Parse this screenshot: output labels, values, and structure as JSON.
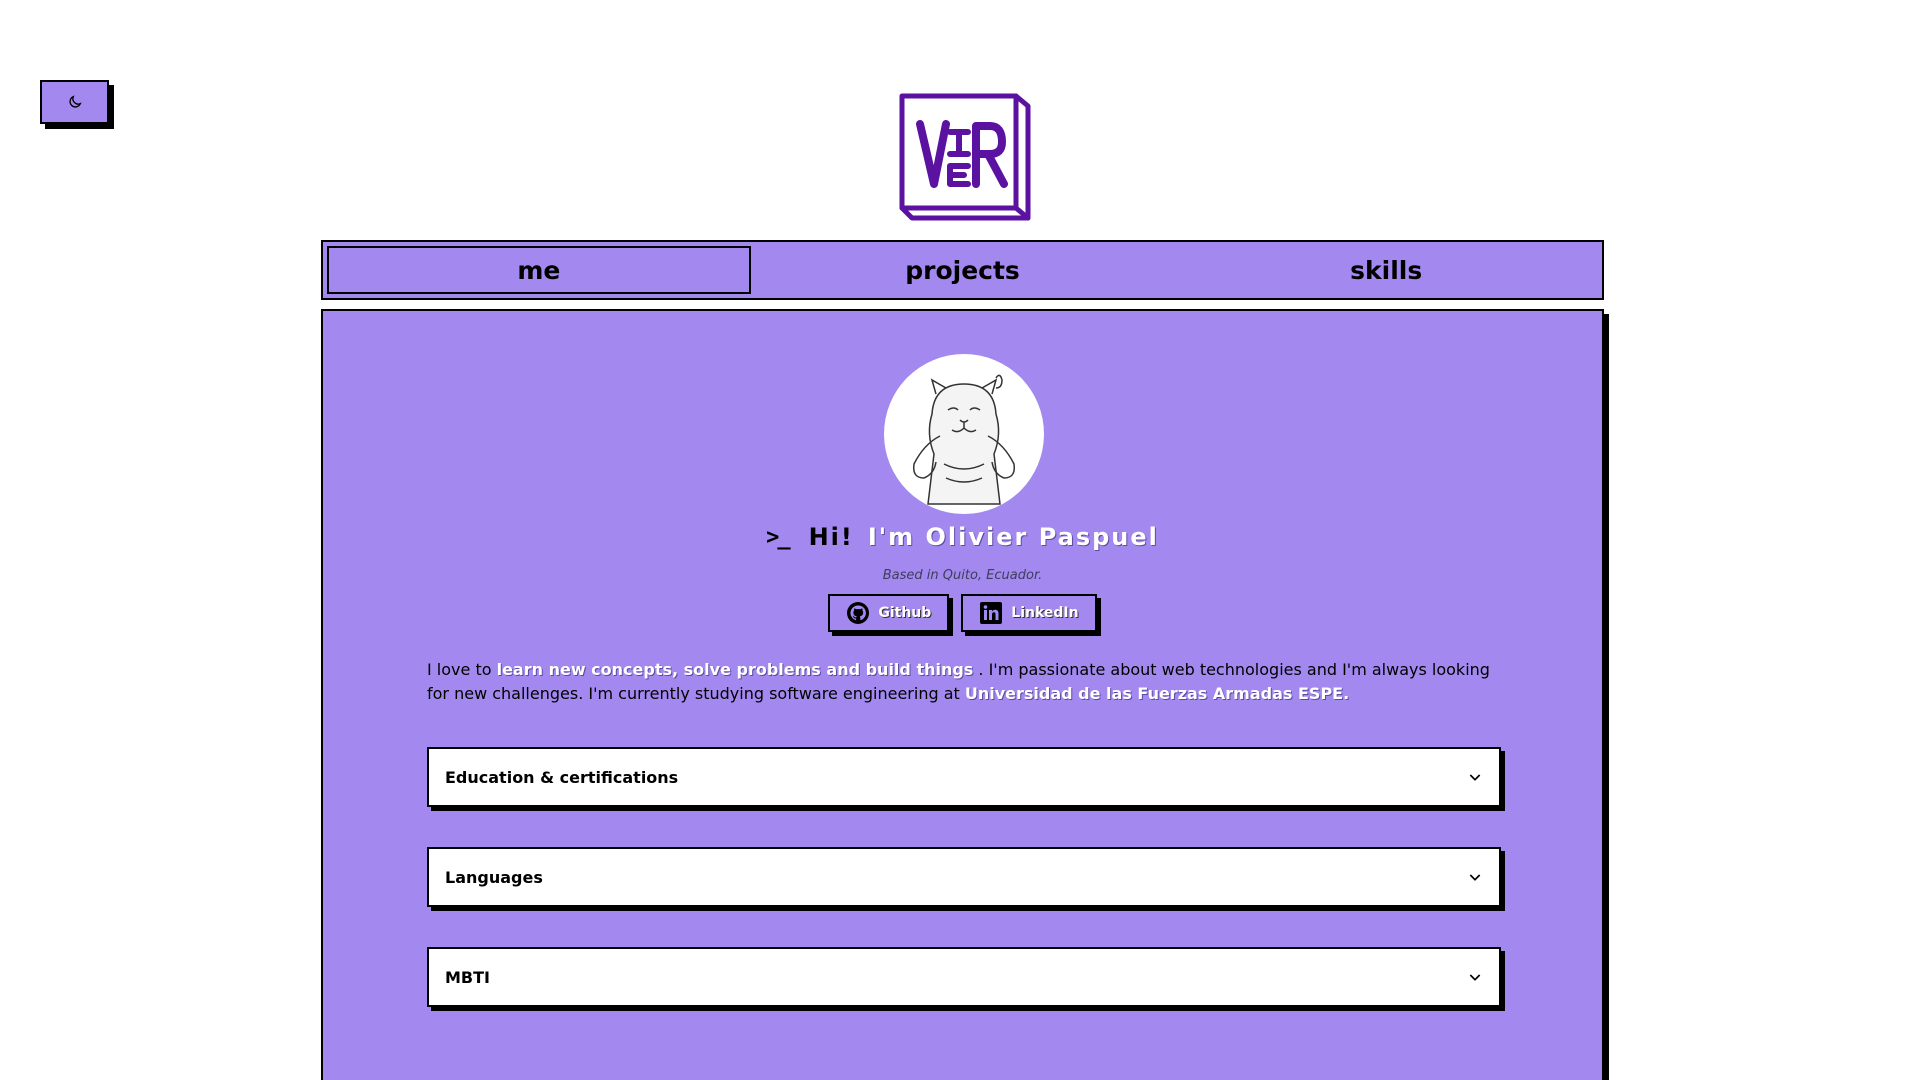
{
  "theme_toggle": {
    "icon": "moon-icon"
  },
  "logo": {
    "icon": "logo-icon",
    "text": "VIER",
    "color": "#5b12a0"
  },
  "nav": {
    "tabs": [
      {
        "label": "me",
        "active": true
      },
      {
        "label": "projects",
        "active": false
      },
      {
        "label": "skills",
        "active": false
      }
    ]
  },
  "profile": {
    "greeting_prefix": "Hi!",
    "name": "I'm Olivier Paspuel",
    "location": "Based in Quito, Ecuador.",
    "socials": [
      {
        "label": "Github",
        "icon": "github-icon"
      },
      {
        "label": "LinkedIn",
        "icon": "linkedin-icon"
      }
    ]
  },
  "bio": {
    "part1": "I love to ",
    "highlight1": "learn new concepts, solve problems and build things",
    "part2": " . I'm passionate about web technologies and I'm always looking for new challenges. I'm currently studying software engineering at ",
    "highlight2": "Universidad de las Fuerzas Armadas ESPE.",
    "part3": ""
  },
  "sections": [
    {
      "label": "Education & certifications"
    },
    {
      "label": "Languages"
    },
    {
      "label": "MBTI"
    }
  ],
  "colors": {
    "accent": "#a389ef",
    "border": "#000000",
    "card": "#ffffff",
    "logo": "#5b12a0"
  }
}
